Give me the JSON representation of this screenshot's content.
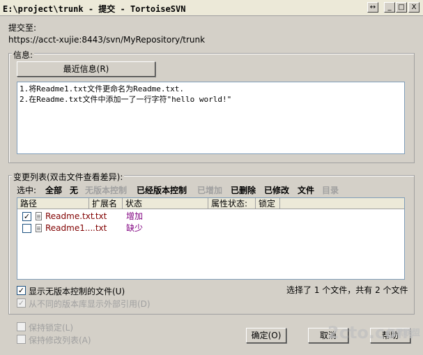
{
  "window": {
    "title": "E:\\project\\trunk - 提交 - TortoiseSVN",
    "buttons": [
      "↔",
      "_",
      "□",
      "X"
    ]
  },
  "commit_to": {
    "label": "提交至:",
    "url": "https://acct-xujie:8443/svn/MyRepository/trunk"
  },
  "message": {
    "group_label": "信息:",
    "recent_button": "最近信息(R)",
    "lines": [
      "1.将Readme1.txt文件更命名为Readme.txt.",
      "2.在Readme.txt文件中添加一了一行字符\"hello world!\""
    ]
  },
  "changes": {
    "group_label": "变更列表(双击文件查看差异):",
    "select_label": "选中:",
    "filters": [
      {
        "label": "全部",
        "enabled": true
      },
      {
        "label": "无",
        "enabled": true
      },
      {
        "label": "无版本控制",
        "enabled": false
      },
      {
        "label": "已经版本控制",
        "enabled": true
      },
      {
        "label": "已增加",
        "enabled": false
      },
      {
        "label": "已删除",
        "enabled": true
      },
      {
        "label": "已修改",
        "enabled": true
      },
      {
        "label": "文件",
        "enabled": true
      },
      {
        "label": "目录",
        "enabled": false
      }
    ],
    "columns": [
      "路径",
      "扩展名",
      "状态",
      "属性状态:",
      "锁定"
    ],
    "rows": [
      {
        "checked": true,
        "path": "Readme.txt",
        "ext": ".txt",
        "status": "增加"
      },
      {
        "checked": false,
        "path": "Readme1...",
        "ext": ".txt",
        "status": "缺少"
      }
    ],
    "show_unversioned": "显示无版本控制的文件(U)",
    "show_externals": "从不同的版本库显示外部引用(D)",
    "summary": "选择了 1 个文件，共有 2 个文件"
  },
  "options": {
    "keep_locks": "保持锁定(L)",
    "keep_changelists": "保持修改列表(A)"
  },
  "buttons": {
    "ok": "确定(O)",
    "cancel": "取消",
    "help": "帮助"
  },
  "watermark": {
    "text": "2cto.com",
    "corner": "红黑联盟"
  },
  "colors": {
    "path_text": "#800000",
    "status_text": "#800080",
    "dialog_bg": "#d4d0c8"
  }
}
